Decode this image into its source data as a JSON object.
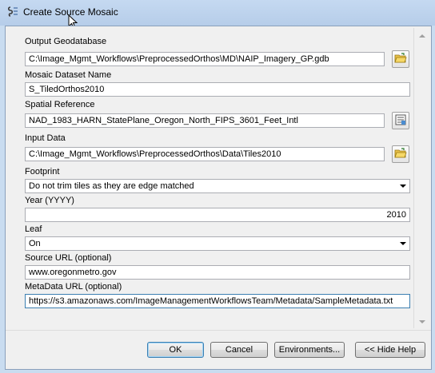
{
  "window": {
    "title": "Create Source Mosaic"
  },
  "fields": {
    "output_geodatabase": {
      "label": "Output Geodatabase",
      "value": "C:\\Image_Mgmt_Workflows\\PreprocessedOrthos\\MD\\NAIP_Imagery_GP.gdb"
    },
    "mosaic_dataset_name": {
      "label": "Mosaic Dataset Name",
      "value": "S_TiledOrthos2010"
    },
    "spatial_reference": {
      "label": "Spatial Reference",
      "value": "NAD_1983_HARN_StatePlane_Oregon_North_FIPS_3601_Feet_Intl"
    },
    "input_data": {
      "label": "Input Data",
      "value": "C:\\Image_Mgmt_Workflows\\PreprocessedOrthos\\Data\\Tiles2010"
    },
    "footprint": {
      "label": "Footprint",
      "value": "Do not trim tiles as they are edge matched"
    },
    "year": {
      "label": "Year (YYYY)",
      "value": "2010"
    },
    "leaf": {
      "label": "Leaf",
      "value": "On"
    },
    "source_url": {
      "label": "Source URL (optional)",
      "value": "www.oregonmetro.gov"
    },
    "metadata_url": {
      "label": "MetaData URL (optional)",
      "value": "https://s3.amazonaws.com/ImageManagementWorkflowsTeam/Metadata/SampleMetadata.txt"
    }
  },
  "buttons": {
    "ok": "OK",
    "cancel": "Cancel",
    "environments": "Environments...",
    "hide_help": "<< Hide Help"
  },
  "icons": {
    "title": "toolbox-script-icon",
    "browse": "open-folder-icon",
    "spatial_ref": "coordinate-system-icon"
  }
}
